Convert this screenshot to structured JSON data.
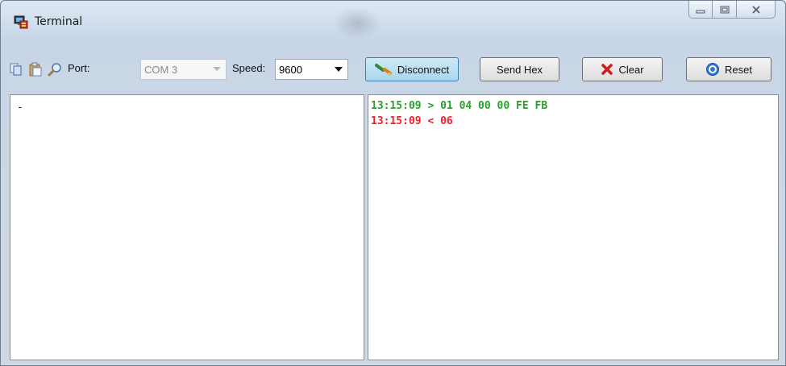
{
  "window": {
    "title": "Terminal",
    "icons": {
      "app": "terminal-app-icon",
      "minimize": "minimize-icon",
      "maximize": "maximize-icon",
      "close": "close-icon"
    }
  },
  "toolbar": {
    "copy_icon": "copy-icon",
    "paste_icon": "paste-icon",
    "find_icon": "magnifier-icon",
    "port_label": "Port:",
    "port_value": "COM 3",
    "speed_label": "Speed:",
    "speed_value": "9600",
    "disconnect_label": "Disconnect",
    "send_hex_label": "Send Hex",
    "clear_label": "Clear",
    "reset_label": "Reset"
  },
  "input_pane": {
    "content": "-"
  },
  "output_pane": {
    "lines": [
      {
        "text": "13:15:09 > 01 04 00 00 FE FB",
        "direction": "sent",
        "color": "#2aa12a"
      },
      {
        "text": "13:15:09 < 06",
        "direction": "received",
        "color": "#f01e2a"
      }
    ]
  }
}
